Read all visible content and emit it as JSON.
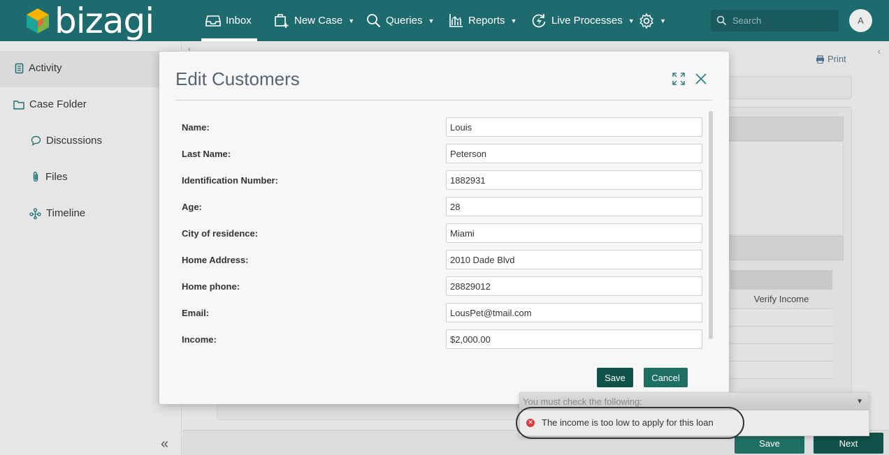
{
  "brand": {
    "name": "bizagi"
  },
  "nav": {
    "items": [
      {
        "label": "Inbox",
        "icon": "inbox-icon",
        "active": true
      },
      {
        "label": "New Case",
        "icon": "new-case-icon"
      },
      {
        "label": "Queries",
        "icon": "search-icon"
      },
      {
        "label": "Reports",
        "icon": "reports-icon"
      },
      {
        "label": "Live Processes",
        "icon": "live-processes-icon"
      }
    ],
    "settings_icon": "gear-icon",
    "search_placeholder": "Search",
    "avatar_initial": "A"
  },
  "sidebar": {
    "items": [
      {
        "label": "Activity",
        "icon": "activity-icon"
      },
      {
        "label": "Case Folder",
        "icon": "folder-icon"
      },
      {
        "label": "Discussions",
        "icon": "discussion-icon"
      },
      {
        "label": "Files",
        "icon": "paperclip-icon"
      },
      {
        "label": "Timeline",
        "icon": "timeline-icon"
      }
    ]
  },
  "background": {
    "print_label": "Print",
    "table_column": "Verify Income",
    "footer_save": "Save",
    "footer_next": "Next"
  },
  "modal": {
    "title": "Edit Customers",
    "fields": [
      {
        "label": "Name:",
        "value": "Louis"
      },
      {
        "label": "Last Name:",
        "value": "Peterson"
      },
      {
        "label": "Identification Number:",
        "value": "1882931"
      },
      {
        "label": "Age:",
        "value": "28"
      },
      {
        "label": "City of residence:",
        "value": "Miami"
      },
      {
        "label": "Home Address:",
        "value": "2010 Dade Blvd"
      },
      {
        "label": "Home phone:",
        "value": "28829012"
      },
      {
        "label": "Email:",
        "value": "LousPet@tmail.com"
      },
      {
        "label": "Income:",
        "value": "$2,000.00"
      }
    ],
    "save_label": "Save",
    "cancel_label": "Cancel"
  },
  "validation": {
    "header": "You must check the following:",
    "message": "The income is too low to apply for this loan"
  },
  "colors": {
    "topbar": "#1e6b6f",
    "primary_button": "#0f5048",
    "secondary_button": "#1f6e63",
    "error": "#d93a3a"
  }
}
